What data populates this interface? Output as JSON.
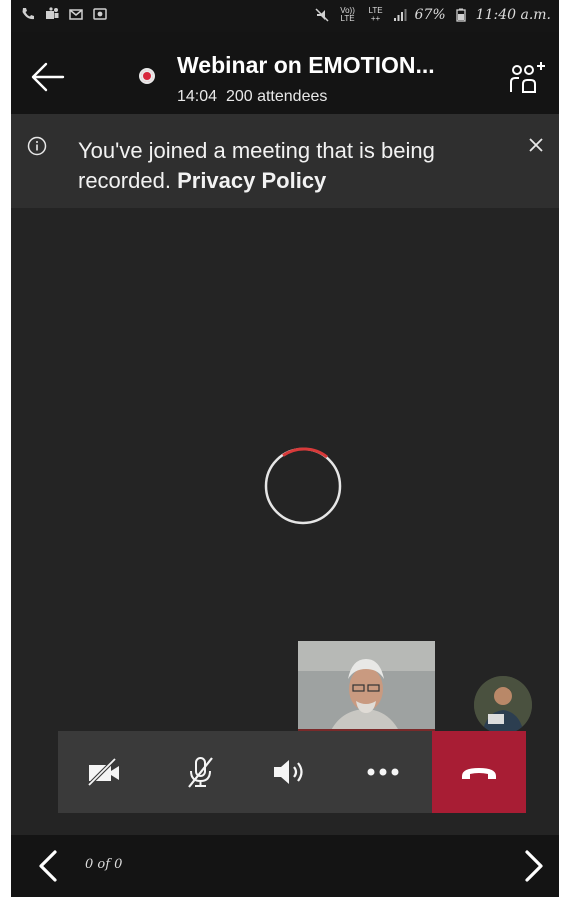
{
  "status_bar": {
    "left_icons": [
      "phone-icon",
      "teams-icon",
      "mail-icon",
      "photo-icon"
    ],
    "signal_labels": [
      "Vo)) LTE",
      "LTE ++"
    ],
    "battery": "67%",
    "time": "11:40 a.m."
  },
  "header": {
    "title": "Webinar on EMOTION...",
    "duration": "14:04",
    "attendees": "200 attendees",
    "recording_color": "#d8263c"
  },
  "banner": {
    "message": "You've joined a meeting that is being recorded.",
    "link": "Privacy Policy"
  },
  "controls": {
    "items": [
      "camera-off-icon",
      "mic-off-icon",
      "speaker-icon",
      "more-icon",
      "hang-up-icon"
    ],
    "hangup_color": "#a81d34"
  },
  "bottom_nav": {
    "page_info": "0 of 0"
  }
}
